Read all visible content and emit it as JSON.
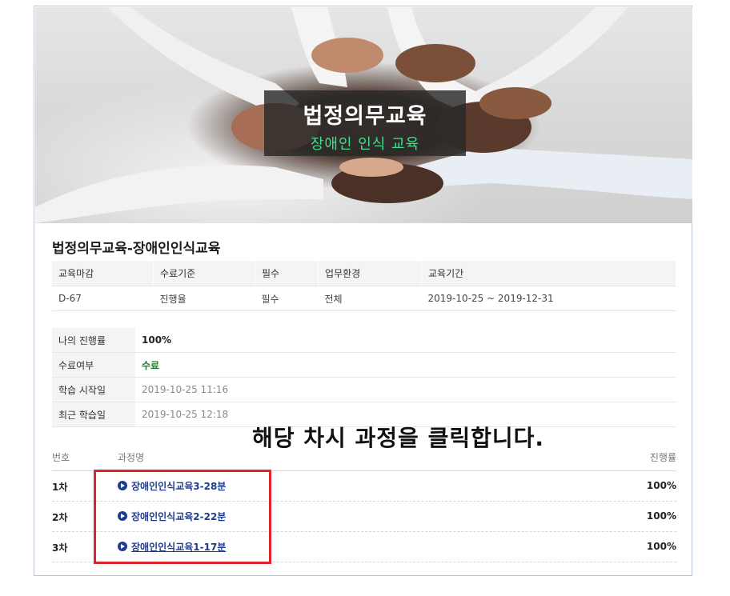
{
  "banner": {
    "title": "법정의무교육",
    "subtitle": "장애인 인식 교육"
  },
  "course": {
    "title": "법정의무교육-장애인인식교육"
  },
  "info_table": {
    "headers": [
      "교육마감",
      "수료기준",
      "필수",
      "업무환경",
      "교육기간"
    ],
    "values": [
      "D-67",
      "진행율",
      "필수",
      "전체",
      "2019-10-25 ~ 2019-12-31"
    ]
  },
  "status": {
    "progress_label": "나의 진행률",
    "progress_value": "100%",
    "completion_label": "수료여부",
    "completion_value": "수료",
    "start_label": "학습 시작일",
    "start_value": "2019-10-25 11:16",
    "recent_label": "최근 학습일",
    "recent_value": "2019-10-25 12:18"
  },
  "instruction": "해당 차시 과정을 클릭합니다.",
  "lesson_list": {
    "col_num": "번호",
    "col_name": "과정명",
    "col_progress": "진행률",
    "rows": [
      {
        "num": "1차",
        "name": "장애인인식교육3-28분",
        "progress": "100%"
      },
      {
        "num": "2차",
        "name": "장애인인식교육2-22분",
        "progress": "100%"
      },
      {
        "num": "3차",
        "name": "장애인인식교육1-17분",
        "progress": "100%"
      }
    ]
  },
  "colors": {
    "highlight_box": "#e0242b",
    "link": "#1f3b8f",
    "completion_green": "#1a7a2a",
    "subtitle_green": "#3fe08a"
  }
}
